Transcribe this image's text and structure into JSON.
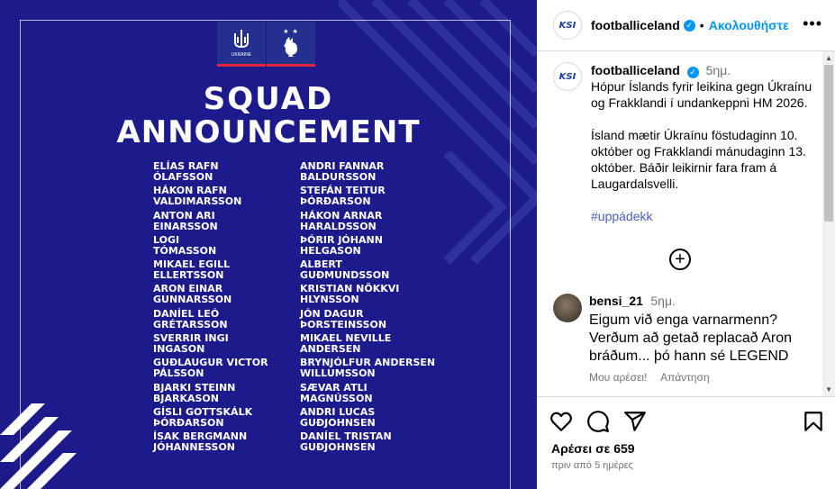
{
  "post_image": {
    "title_line1": "SQUAD",
    "title_line2": "ANNOUNCEMENT",
    "badge_ukraine": "UKRAINE",
    "badge_france_stars": "★ ★",
    "roster_left": [
      [
        "ELÍAS RAFN",
        "ÓLAFSSON"
      ],
      [
        "HÁKON RAFN",
        "VALDIMARSSON"
      ],
      [
        "ANTON ARI",
        "EINARSSON"
      ],
      [
        "LOGI",
        "TÓMASSON"
      ],
      [
        "MIKAEL EGILL",
        "ELLERTSSON"
      ],
      [
        "ARON EINAR",
        "GUNNARSSON"
      ],
      [
        "DANÍEL LEÓ",
        "GRÉTARSSON"
      ],
      [
        "SVERRIR INGI",
        "INGASON"
      ],
      [
        "GUÐLAUGUR VICTOR",
        "PÁLSSON"
      ],
      [
        "BJARKI STEINN",
        "BJARKASON"
      ],
      [
        "GÍSLI GOTTSKÁLK",
        "ÞÓRÐARSON"
      ],
      [
        "ÍSAK BERGMANN",
        "JÓHANNESSON"
      ]
    ],
    "roster_right": [
      [
        "ANDRI FANNAR",
        "BALDURSSON"
      ],
      [
        "STEFÁN TEITUR",
        "ÞÓRÐARSON"
      ],
      [
        "HÁKON ARNAR",
        "HARALDSSON"
      ],
      [
        "ÞÓRIR JÓHANN",
        "HELGASON"
      ],
      [
        "ALBERT",
        "GUÐMUNDSSON"
      ],
      [
        "KRISTIAN NÖKKVI",
        "HLYNSSON"
      ],
      [
        "JÓN DAGUR",
        "ÞORSTEINSSON"
      ],
      [
        "MIKAEL NEVILLE",
        "ANDERSEN"
      ],
      [
        "BRYNJÓLFUR ANDERSEN",
        "WILLUMSSON"
      ],
      [
        "SÆVAR ATLI",
        "MAGNÚSSON"
      ],
      [
        "ANDRI LUCAS",
        "GUÐJOHNSEN"
      ],
      [
        "DANÍEL TRISTAN",
        "GUÐJOHNSEN"
      ]
    ]
  },
  "header": {
    "avatar_text": "KSI",
    "username": "footballiceland",
    "verified": "✓",
    "separator": "•",
    "follow_label": "Ακολουθήστε",
    "more_label": "•••"
  },
  "caption": {
    "avatar_text": "KSI",
    "username": "footballiceland",
    "verified": "✓",
    "time": "5ημ.",
    "paragraph1": "Hópur Íslands fyrir leikina gegn Úkraínu og Frakklandi í undankeppni HM 2026.",
    "paragraph2": "Ísland mætir Úkraínu föstudaginn 10. október og Frakklandi mánudaginn 13. október. Báðir leikirnir fara fram á Laugardalsvelli.",
    "hashtag": "#uppádekk"
  },
  "load_more_label": "+",
  "comment": {
    "username": "bensi_21",
    "time": "5ημ.",
    "text": "Eigum við enga varnarmenn? Verðum að getað replacað Aron bráðum... þó hann sé LEGEND",
    "like_label": "Μου αρέσει!",
    "reply_label": "Απάντηση"
  },
  "actions": {
    "icons": [
      "heart-icon",
      "comment-icon",
      "share-icon",
      "bookmark-icon"
    ],
    "likes": "Αρέσει σε 659",
    "time": "πριν από 5 ημέρες"
  },
  "colors": {
    "image_bg": "#1d1a8c",
    "accent": "#0095f6",
    "muted": "#737373"
  }
}
